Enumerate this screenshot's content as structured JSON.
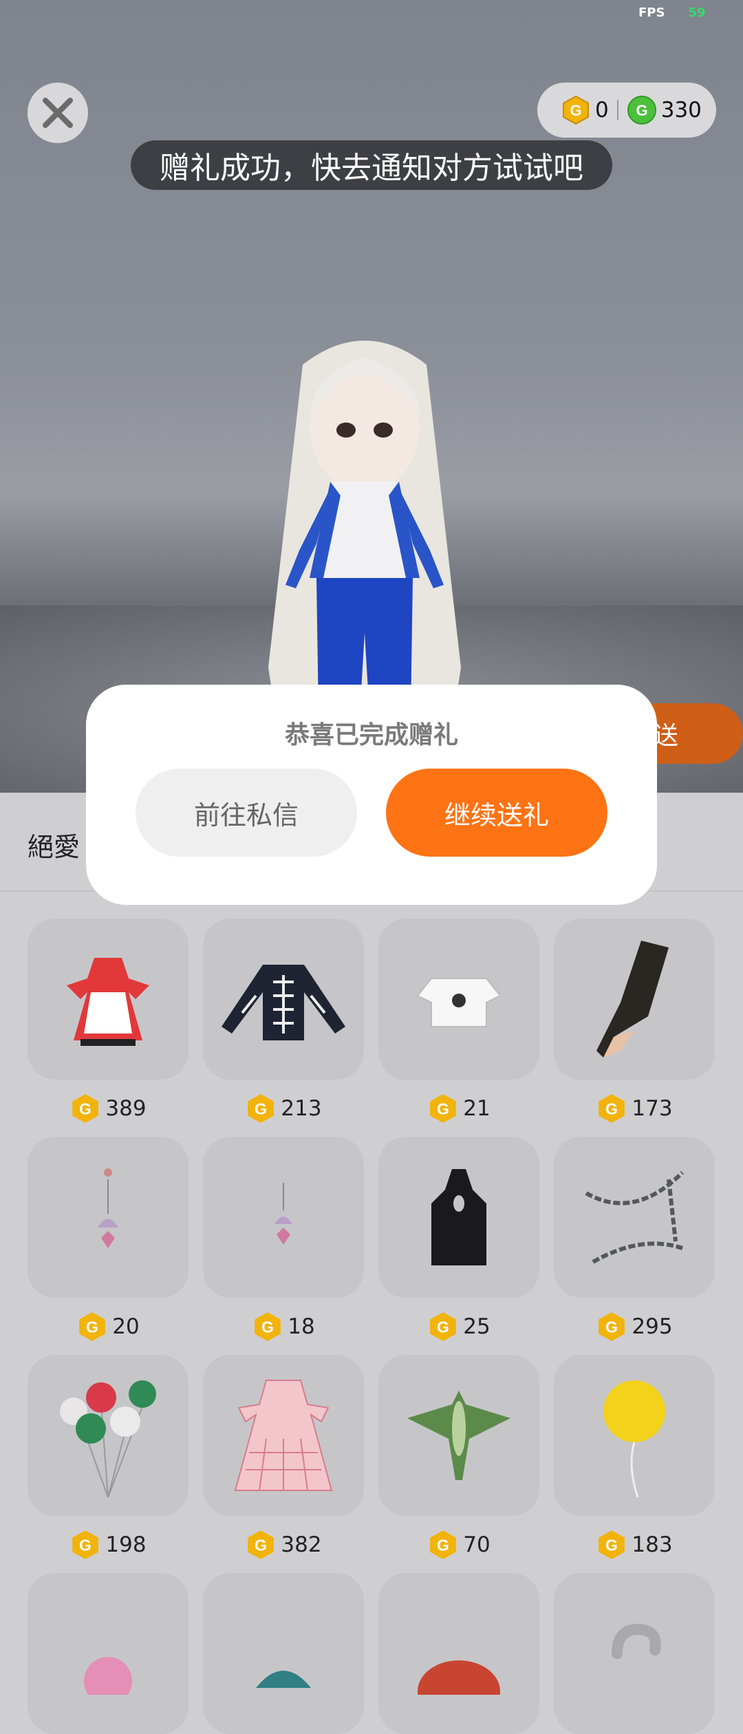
{
  "status": {
    "fps_label": "FPS",
    "fps_value": "59"
  },
  "wallet": {
    "gold_amount": "0",
    "green_amount": "330"
  },
  "toast": "赠礼成功，快去通知对方试试吧",
  "send_button_partial": "送",
  "sheet": {
    "title_partial": "絕愛"
  },
  "modal": {
    "title": "恭喜已完成赠礼",
    "secondary_button": "前往私信",
    "primary_button": "继续送礼"
  },
  "items": [
    {
      "name": "maid-dress",
      "price": "389"
    },
    {
      "name": "skeleton-jacket",
      "price": "213"
    },
    {
      "name": "white-crop-top",
      "price": "21"
    },
    {
      "name": "lace-glove",
      "price": "173"
    },
    {
      "name": "bell-earring",
      "price": "20"
    },
    {
      "name": "bell-earring-small",
      "price": "18"
    },
    {
      "name": "black-halter-top",
      "price": "25"
    },
    {
      "name": "chain-accessory",
      "price": "295"
    },
    {
      "name": "balloon-bunch",
      "price": "198"
    },
    {
      "name": "pink-lolita-dress",
      "price": "382"
    },
    {
      "name": "bird-kite",
      "price": "70"
    },
    {
      "name": "yellow-balloon",
      "price": "183"
    }
  ],
  "colors": {
    "accent": "#FE7314",
    "coin_gold": "#F2B30A",
    "coin_green": "#4CBF3C"
  }
}
